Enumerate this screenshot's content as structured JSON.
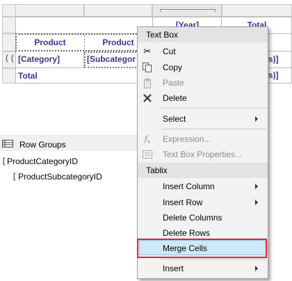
{
  "tablix": {
    "column_headers": [
      "[Year]",
      "Total"
    ],
    "header_row": [
      "Product",
      "Product"
    ],
    "detail_row": [
      "[Category]",
      "[Subcategor",
      "s)]"
    ],
    "total_row": [
      "Total",
      "s)]"
    ]
  },
  "row_groups": {
    "title": "Row Groups",
    "items": [
      "ProductCategoryID",
      "ProductSubcategoryID"
    ],
    "bracket_open": "["
  },
  "context_menu": {
    "sections": [
      "Text Box",
      "Tablix"
    ],
    "items": {
      "cut": "Cut",
      "copy": "Copy",
      "paste": "Paste",
      "delete": "Delete",
      "select": "Select",
      "expression": "Expression...",
      "text_box_properties": "Text Box Properties...",
      "insert_column": "Insert Column",
      "insert_row": "Insert Row",
      "delete_columns": "Delete Columns",
      "delete_rows": "Delete Rows",
      "merge_cells": "Merge Cells",
      "insert": "Insert"
    },
    "disabled": [
      "Paste",
      "Expression...",
      "Text Box Properties..."
    ],
    "highlighted": "Merge Cells"
  },
  "colors": {
    "header_text": "#333399",
    "highlight": "#cfe8f6",
    "callout_border": "#e3242b"
  },
  "icons": [
    "scissors-icon",
    "copy-icon",
    "paste-icon",
    "delete-x-icon",
    "function-icon",
    "properties-icon",
    "submenu-arrow-icon",
    "row-groups-icon"
  ]
}
